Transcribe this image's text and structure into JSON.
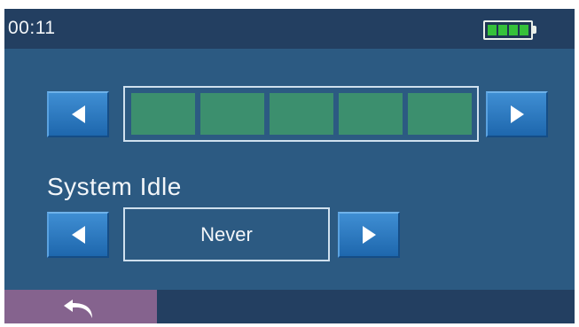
{
  "status_bar": {
    "time": "00:11",
    "battery_icon": "battery-full-icon",
    "battery_level": 1.0,
    "battery_color": "#35c13a"
  },
  "level_setting": {
    "decrease_icon": "arrow-left-icon",
    "increase_icon": "arrow-right-icon",
    "segments_total": 5,
    "segments_filled": 5,
    "segment_color": "#3c8f6e"
  },
  "system_idle": {
    "label": "System Idle",
    "value": "Never",
    "decrease_icon": "arrow-left-icon",
    "increase_icon": "arrow-right-icon"
  },
  "bottom_bar": {
    "back_icon": "back-return-icon",
    "back_button_color": "#85638e"
  },
  "colors": {
    "background": "#2c5a82",
    "bar": "#233f61",
    "button": "#2b78c0"
  }
}
